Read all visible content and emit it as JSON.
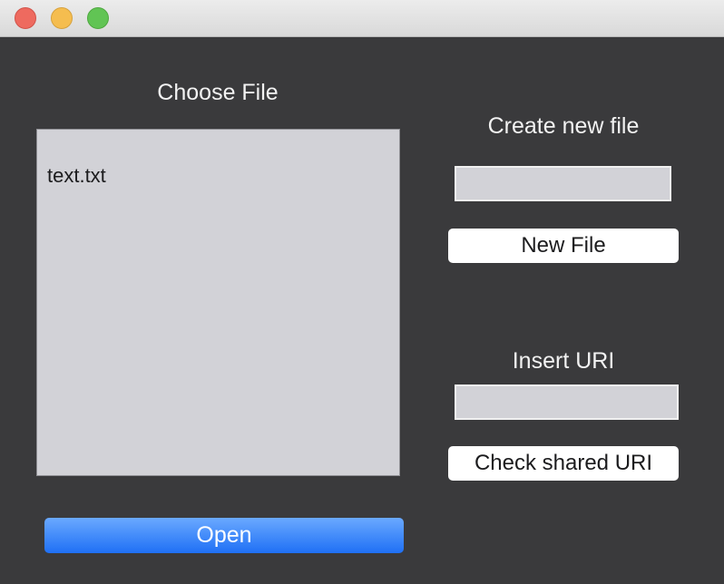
{
  "window": {
    "controls": [
      "close",
      "minimize",
      "maximize"
    ]
  },
  "left_panel": {
    "title": "Choose File",
    "files": [
      "text.txt"
    ],
    "open_button": "Open"
  },
  "right_panel": {
    "create_title": "Create new file",
    "new_file_input_value": "",
    "new_file_button": "New File",
    "uri_title": "Insert URI",
    "uri_input_value": "",
    "check_button": "Check shared URI"
  },
  "colors": {
    "window_bg": "#3a3a3c",
    "list_bg": "#d2d2d7",
    "accent_blue": "#1f70f5",
    "close": "#ee6a5f",
    "minimize": "#f5bd4f",
    "maximize": "#61c454"
  }
}
